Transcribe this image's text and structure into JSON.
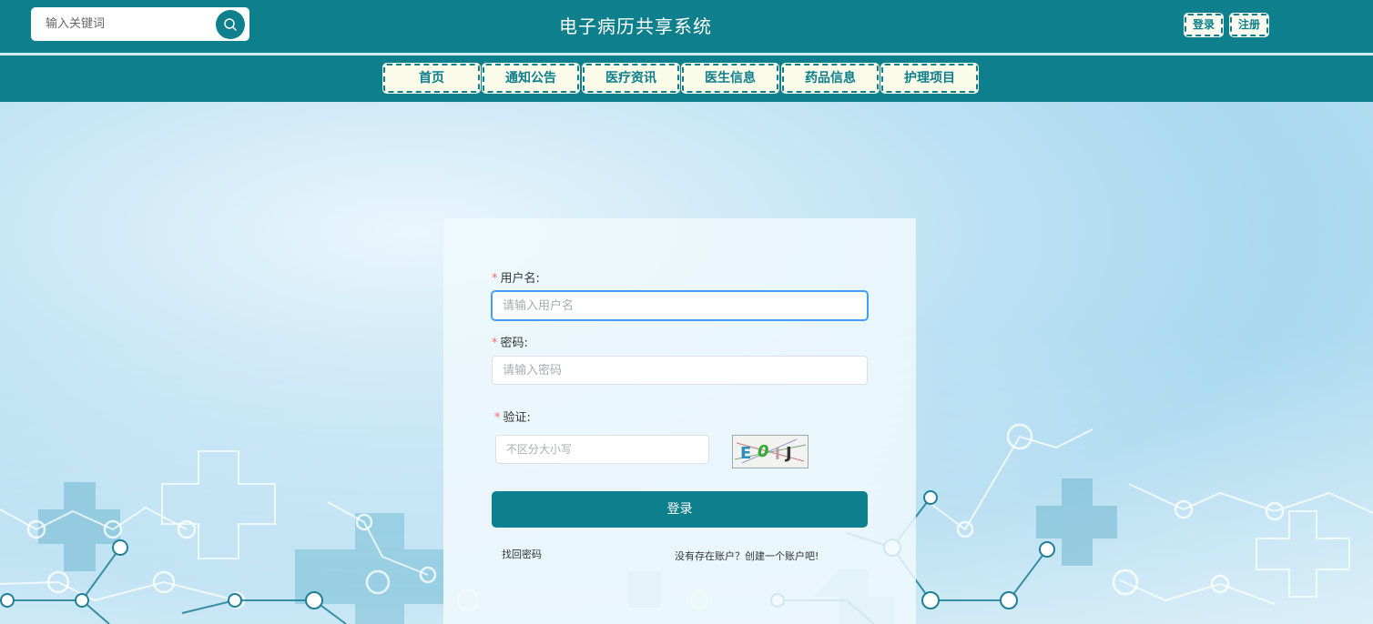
{
  "header": {
    "search_placeholder": "输入关键词",
    "title": "电子病历共享系统",
    "login_label": "登录",
    "register_label": "注册"
  },
  "nav": {
    "items": [
      "首页",
      "通知公告",
      "医疗资讯",
      "医生信息",
      "药品信息",
      "护理项目"
    ]
  },
  "form": {
    "username_label": "用户名:",
    "username_placeholder": "请输入用户名",
    "password_label": "密码:",
    "password_placeholder": "请输入密码",
    "captcha_label": "验证:",
    "captcha_placeholder": "不区分大小写",
    "captcha_text": "E0lJ",
    "submit_label": "登录",
    "forgot_link": "找回密码",
    "register_link": "没有存在账户？创建一个账户吧!"
  },
  "colors": {
    "primary": "#0e7f8c",
    "nav_bg": "#fbfbea",
    "required": "#f56c6c",
    "focus": "#409eff"
  }
}
